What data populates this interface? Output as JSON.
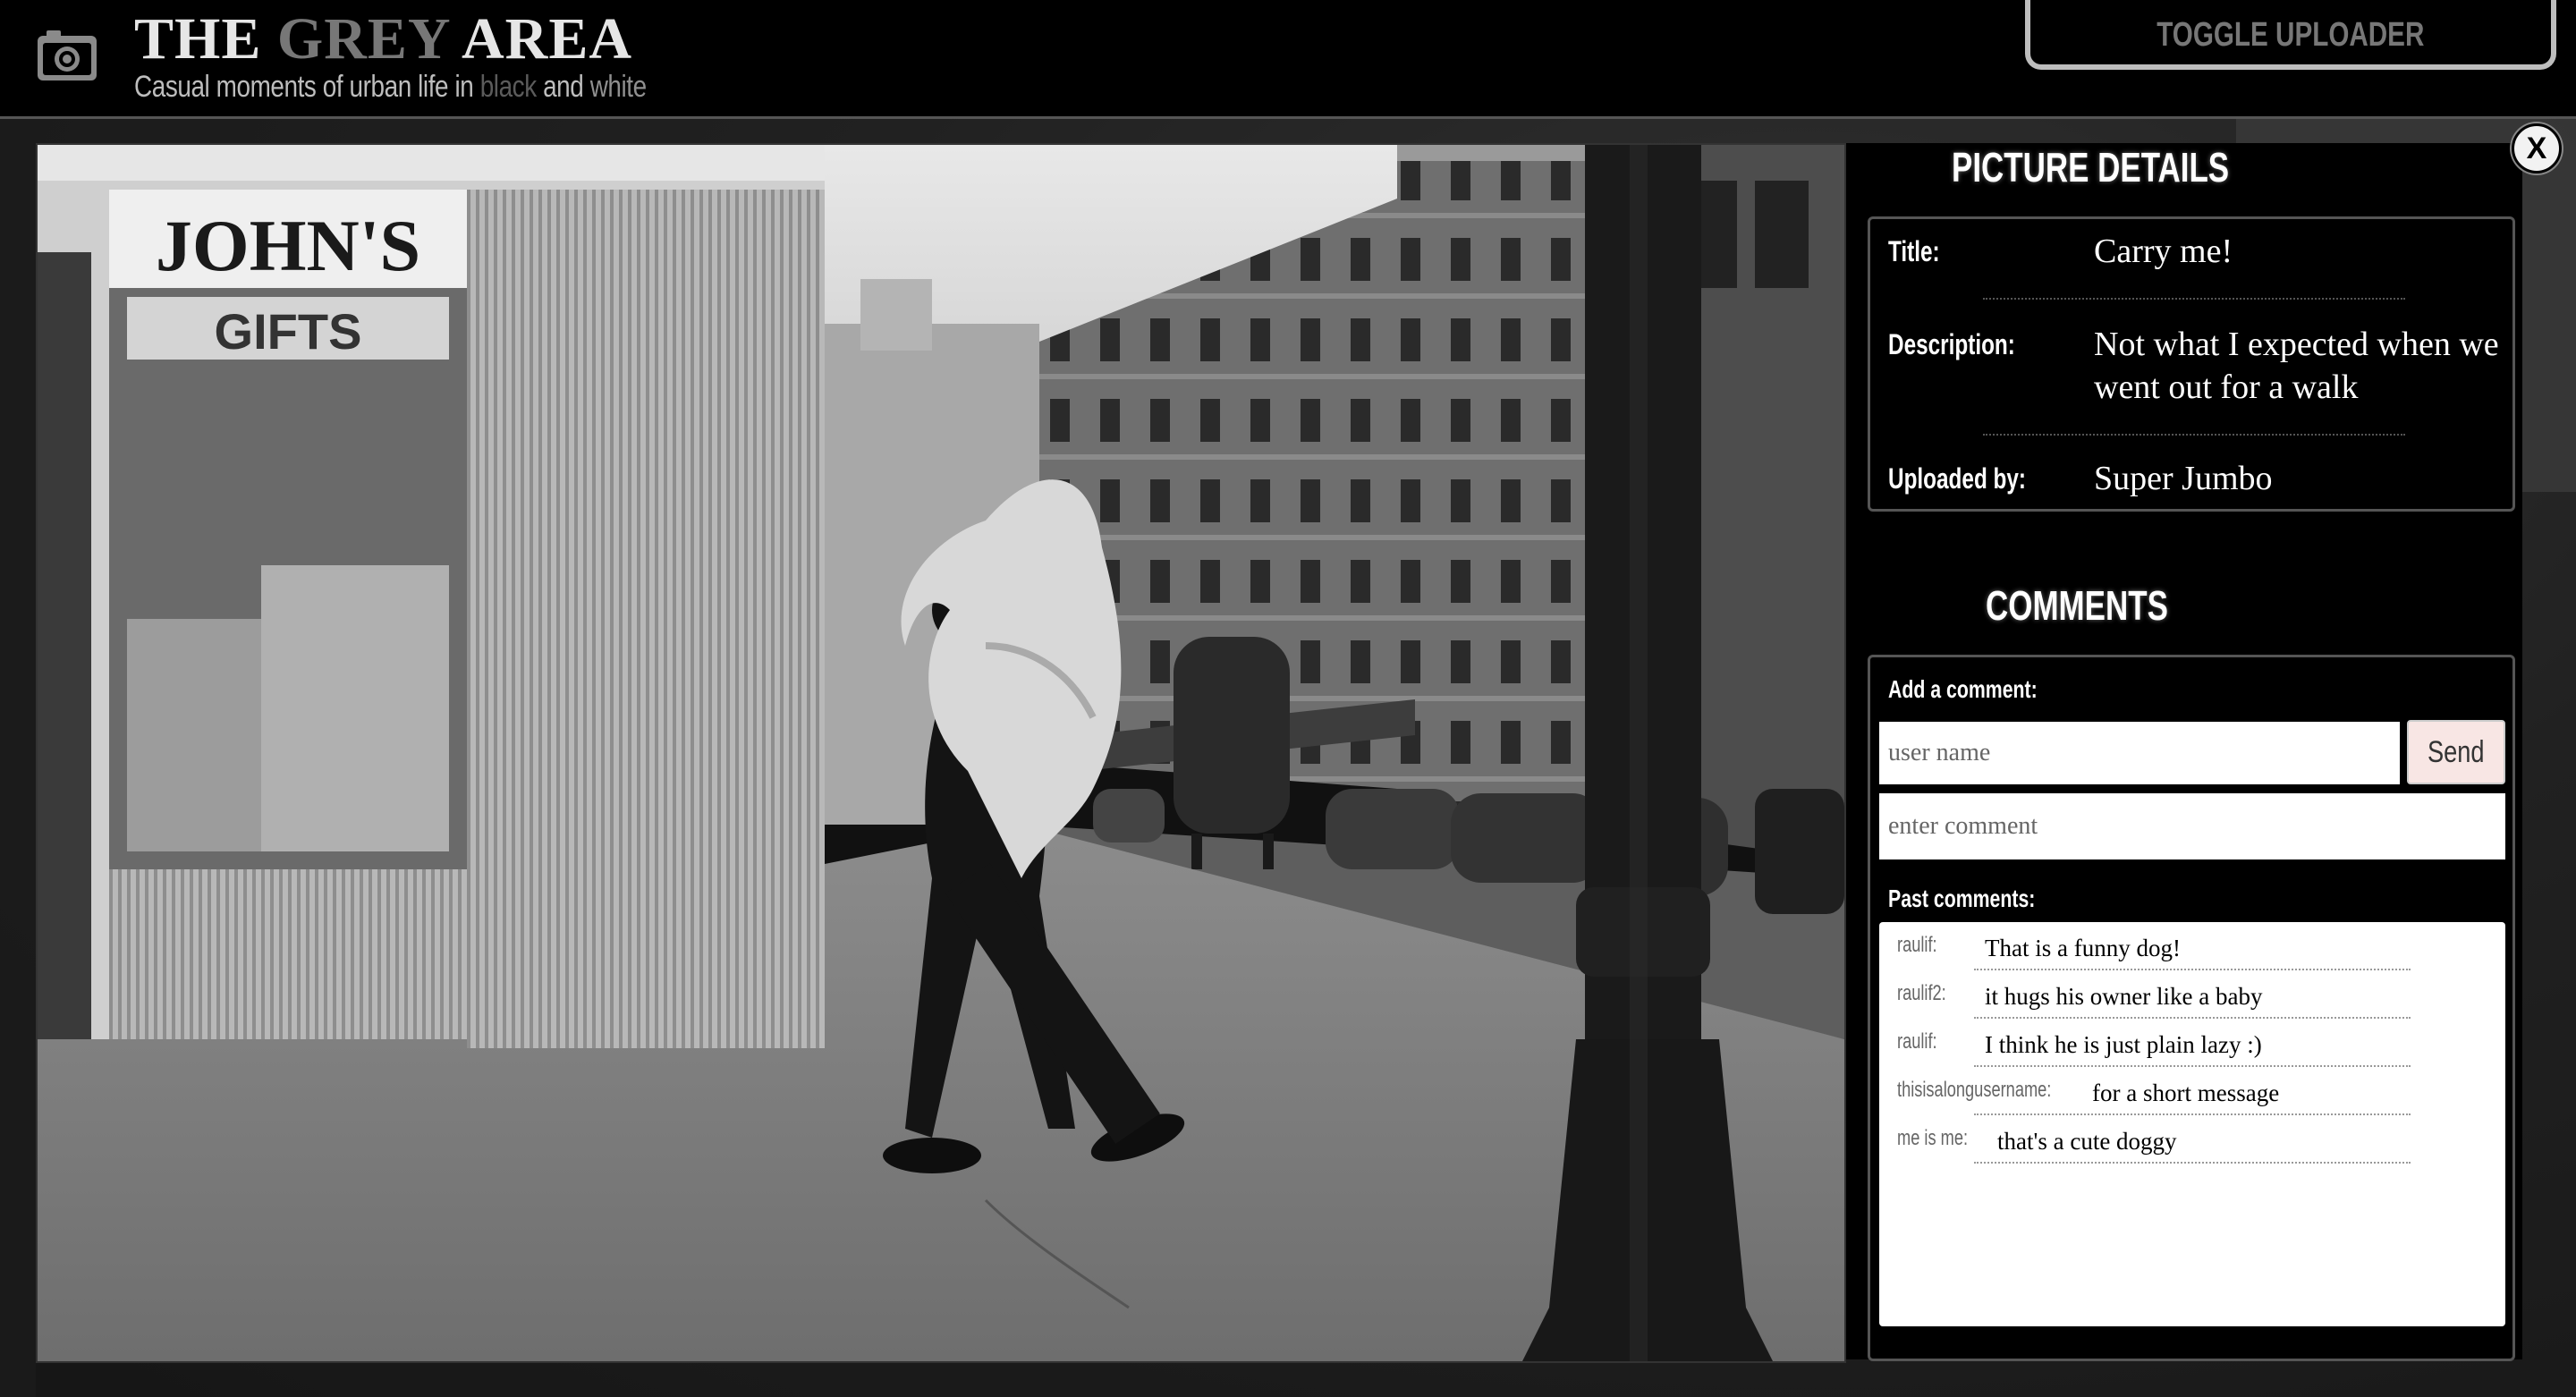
{
  "header": {
    "brand_the": "THE",
    "brand_grey": "GREY",
    "brand_area": "AREA",
    "subtitle_prefix": "Casual moments of urban life in",
    "subtitle_black": "black",
    "subtitle_and": "and",
    "subtitle_white": "white",
    "toggle_uploader_label": "TOGGLE UPLOADER",
    "logo_icon": "camera-icon"
  },
  "modal": {
    "close_label": "X",
    "photo_alt": "Black and white street photo: a man carrying a large shaggy dog over his shoulder, walking past a kiosk with a JOHN'S GIFTS sign and a lamppost",
    "photo_sign_johns": "JOHN'S",
    "photo_sign_gifts": "GIFTS"
  },
  "details": {
    "heading": "PICTURE DETAILS",
    "title_label": "Title:",
    "title_value": "Carry me!",
    "description_label": "Description:",
    "description_value": "Not what I expected when we went out for a walk",
    "uploaded_label": "Uploaded by:",
    "uploaded_value": "Super Jumbo"
  },
  "comments": {
    "heading": "COMMENTS",
    "add_label": "Add a comment:",
    "username_placeholder": "user name",
    "comment_placeholder": "enter comment",
    "send_label": "Send",
    "past_label": "Past comments:",
    "items": [
      {
        "user": "raulif:",
        "text": "That is a funny dog!"
      },
      {
        "user": "raulif2:",
        "text": "it hugs his owner like a baby"
      },
      {
        "user": "raulif:",
        "text": "I think he is just plain lazy :)"
      },
      {
        "user": "thisisalongusername:",
        "text": "for a short message"
      },
      {
        "user": "me is me:",
        "text": "that's a cute doggy"
      }
    ]
  },
  "colors": {
    "header_bg": "#000000",
    "accent_send": "#f8e6e4",
    "grey_word": "#777777"
  }
}
